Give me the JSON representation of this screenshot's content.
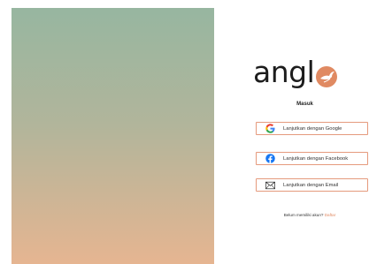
{
  "hero": {
    "gradient_top": "#97b6a0",
    "gradient_bottom": "#e6b591"
  },
  "brand": {
    "logo_text": "angl",
    "logo_mark_icon": "bird-badge-icon",
    "accent": "#e08a62"
  },
  "auth": {
    "title": "Masuk",
    "buttons": [
      {
        "label": "Lanjutkan dengan Google",
        "icon": "google-icon"
      },
      {
        "label": "Lanjutkan dengan Facebook",
        "icon": "facebook-icon"
      },
      {
        "label": "Lanjutkan dengan Email",
        "icon": "mail-icon"
      }
    ],
    "signup_prompt": "Belum memiliki akun?",
    "signup_link": "Daftar"
  }
}
